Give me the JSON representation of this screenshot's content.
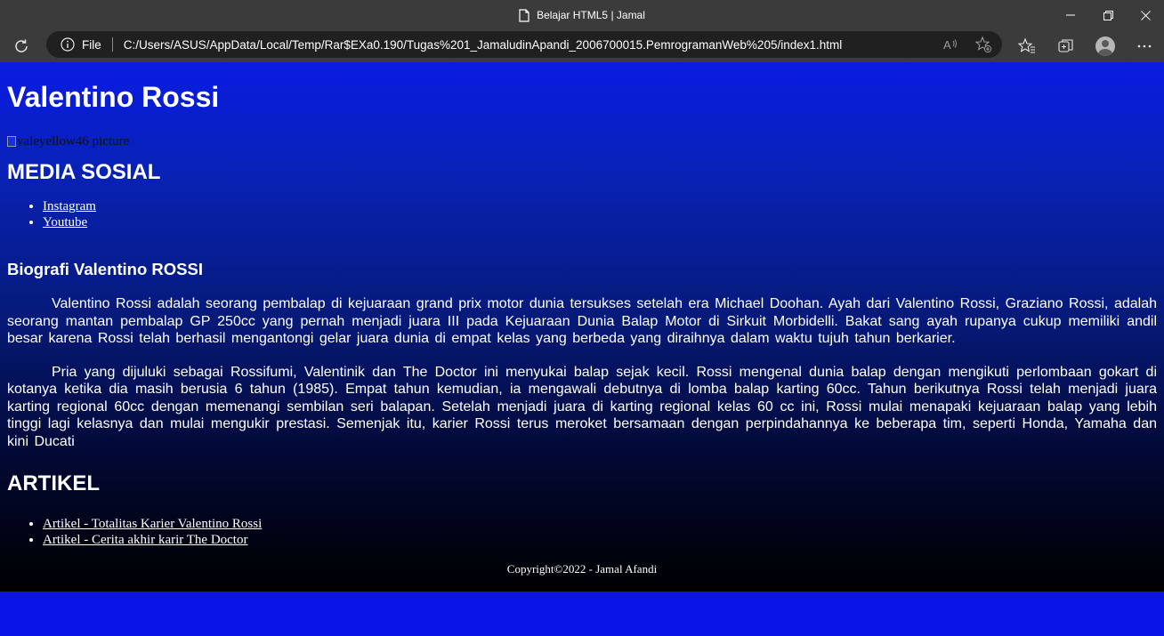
{
  "window": {
    "title": "Belajar HTML5 | Jamal"
  },
  "addressbar": {
    "scheme_label": "File",
    "url": "C:/Users/ASUS/AppData/Local/Temp/Rar$EXa0.190/Tugas%201_JamaludinApandi_2006700015.PemrogramanWeb%205/index1.html"
  },
  "page": {
    "title": "Valentino Rossi",
    "image_alt": "valeyellow46 picture",
    "social_heading": "MEDIA SOSIAL",
    "social_links": [
      "Instagram",
      "Youtube"
    ],
    "bio_heading": "Biografi Valentino ROSSI",
    "bio_paragraphs": [
      "Valentino Rossi adalah seorang pembalap di kejuaraan grand prix motor dunia tersukses setelah era Michael Doohan. Ayah dari Valentino Rossi, Graziano Rossi, adalah seorang mantan pembalap GP 250cc yang pernah menjadi juara III pada Kejuaraan Dunia Balap Motor di Sirkuit Morbidelli. Bakat sang ayah rupanya cukup memiliki andil besar karena Rossi telah berhasil mengantongi gelar juara dunia di empat kelas yang berbeda yang diraihnya dalam waktu tujuh tahun berkarier.",
      "Pria yang dijuluki sebagai Rossifumi, Valentinik dan The Doctor ini menyukai balap sejak kecil. Rossi mengenal dunia balap dengan mengikuti perlombaan gokart di kotanya ketika dia masih berusia 6 tahun (1985). Empat tahun kemudian, ia mengawali debutnya di lomba balap karting 60cc. Tahun berikutnya Rossi telah menjadi juara karting regional 60cc dengan memenangi sembilan seri balapan. Setelah menjadi juara di karting regional kelas 60 cc ini, Rossi mulai menapaki kejuaraan balap yang lebih tinggi lagi kelasnya dan mulai mengukir prestasi. Semenjak itu, karier Rossi terus meroket bersamaan dengan perpindahannya ke beberapa tim, seperti Honda, Yamaha dan kini Ducati"
    ],
    "article_heading": "ARTIKEL",
    "article_links": [
      "Artikel - Totalitas Karier Valentino Rossi",
      "Artikel - Cerita akhir karir The Doctor"
    ],
    "footer": "Copyright©2022 - Jamal Afandi"
  },
  "colors": {
    "chrome": "#3b3b3b",
    "addressbar": "#202020",
    "page_top": "#0a1be2",
    "page_bottom": "#000000",
    "viewport_bg": "#0a14e8"
  },
  "icons": {
    "tab": "document-icon",
    "reload": "refresh-icon",
    "site_info": "info-icon",
    "read_aloud": "read-aloud-icon",
    "favorite_add": "add-favorite-icon",
    "favorites": "favorites-icon",
    "collections": "collections-icon",
    "profile": "profile-avatar",
    "menu": "more-icon"
  }
}
